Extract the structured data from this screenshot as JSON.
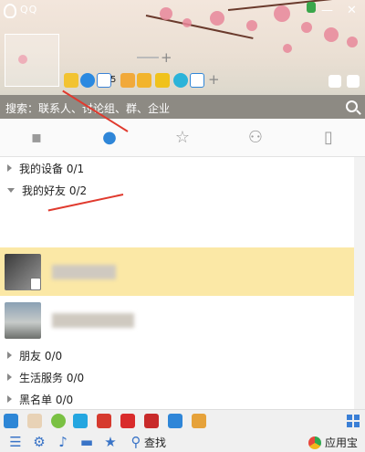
{
  "header": {
    "logo_text": "QQ",
    "mail_count": "5",
    "window_buttons": [
      "minimize",
      "close"
    ]
  },
  "search": {
    "placeholder": "搜索：联系人、讨论组、群、企业"
  },
  "tabs": [
    {
      "icon": "message-icon",
      "active": false
    },
    {
      "icon": "contacts-icon",
      "active": true
    },
    {
      "icon": "star-icon",
      "active": false
    },
    {
      "icon": "group-icon",
      "active": false
    },
    {
      "icon": "phone-icon",
      "active": false
    }
  ],
  "groups": {
    "devices": "我的设备 0/1",
    "friends": "我的好友 0/2",
    "pals": "朋友 0/0",
    "services": "生活服务 0/0",
    "blacklist": "黑名单 0/0"
  },
  "footer": {
    "find": "查找",
    "appstore": "应用宝"
  },
  "colors": {
    "accent": "#2f86d8",
    "selected_row": "#fbe8a6",
    "annotation_arrow": "#e03a2e"
  }
}
